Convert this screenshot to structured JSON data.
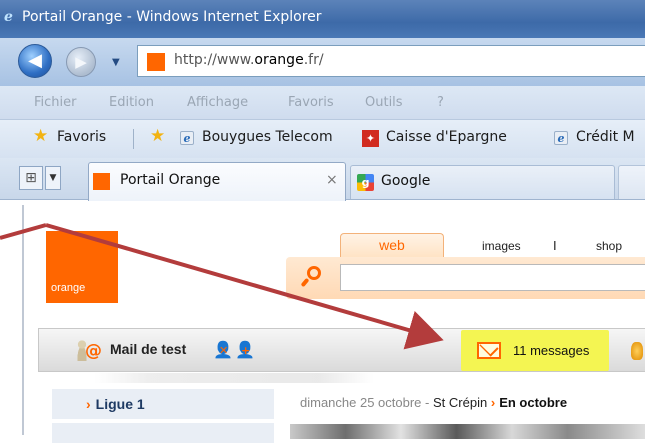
{
  "window": {
    "title": "Portail Orange - Windows Internet Explorer",
    "address": {
      "prefix": "http://www.",
      "domain": "orange",
      "suffix": ".fr/"
    }
  },
  "menu": [
    "Fichier",
    "Edition",
    "Affichage",
    "Favoris",
    "Outils",
    "?"
  ],
  "favorites_bar": {
    "favoris_label": "Favoris",
    "links": [
      "Bouygues Telecom",
      "Caisse d'Epargne",
      "Crédit M"
    ]
  },
  "tabs": [
    {
      "label": "Portail Orange",
      "close": "×"
    },
    {
      "label": "Google"
    }
  ],
  "page": {
    "logo_text": "orange",
    "search_tabs": {
      "web": "web",
      "images": "images",
      "separator": "I",
      "shop": "shop"
    },
    "search_placeholder": "",
    "toolbar": {
      "mail_label": "Mail de test",
      "messages": "11 messages"
    },
    "sidebar": [
      {
        "label": "Ligue 1",
        "chevron": "›"
      }
    ],
    "date": {
      "day": "dimanche 25 octobre",
      "dash": "-",
      "saint": "St Crépin",
      "more_chevron": "›",
      "more": "En octobre"
    }
  },
  "colors": {
    "orange": "#ff6600",
    "highlight": "#f4f552",
    "annotation_arrow": "#b33c3c"
  }
}
